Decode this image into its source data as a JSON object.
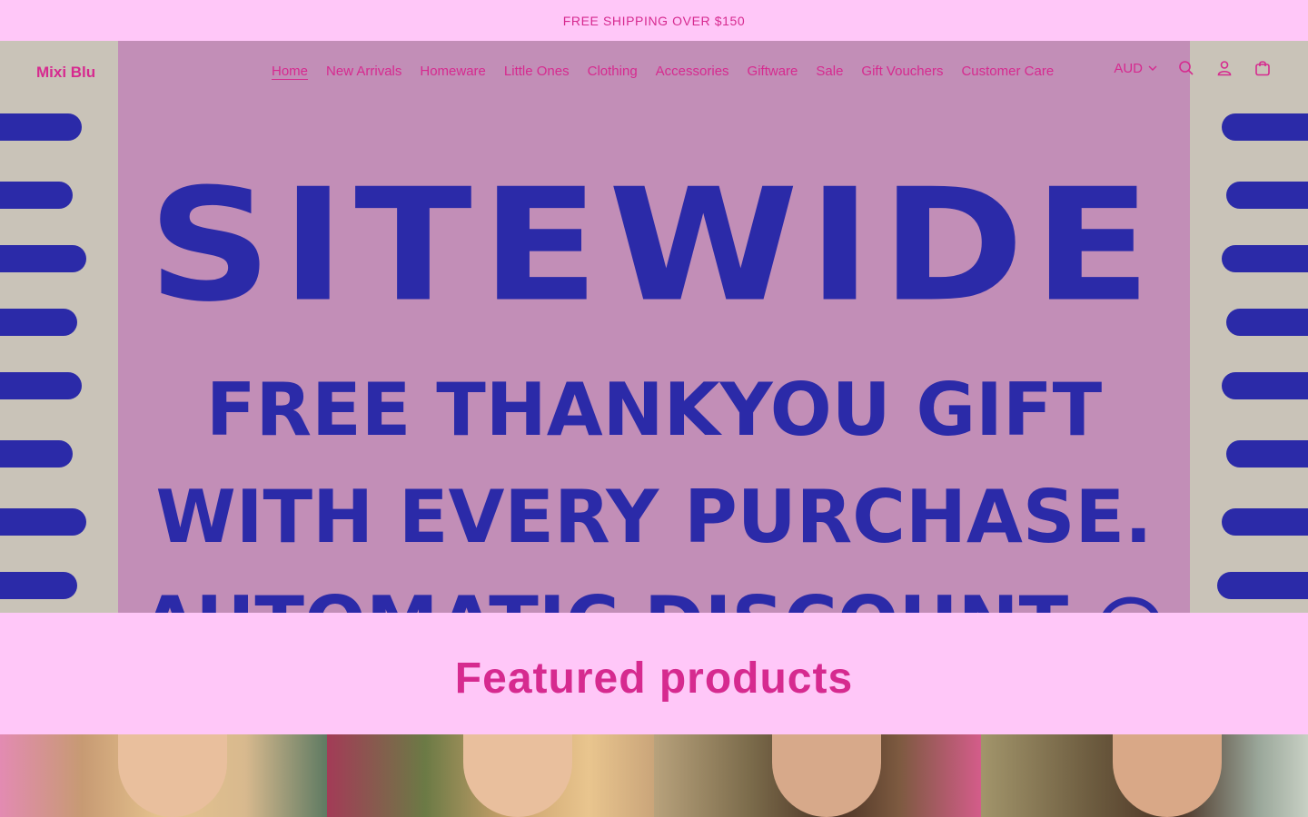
{
  "announcement": {
    "text": "FREE SHIPPING OVER $150"
  },
  "header": {
    "logo": "Mixi Blu",
    "nav": [
      {
        "label": "Home",
        "active": true
      },
      {
        "label": "New Arrivals"
      },
      {
        "label": "Homeware"
      },
      {
        "label": "Little Ones"
      },
      {
        "label": "Clothing"
      },
      {
        "label": "Accessories"
      },
      {
        "label": "Giftware"
      },
      {
        "label": "Sale"
      },
      {
        "label": "Gift Vouchers"
      },
      {
        "label": "Customer Care"
      }
    ],
    "currency": "AUD",
    "icons": [
      "chevron-down-icon",
      "search-icon",
      "account-icon",
      "cart-icon"
    ]
  },
  "hero": {
    "line1": "SITEWIDE",
    "line2": "FREE THANKYOU GIFT",
    "line3": "WITH EVERY PURCHASE.",
    "line4": "AUTOMATIC DISCOUNT @"
  },
  "featured": {
    "title": "Featured products"
  },
  "colors": {
    "accent": "#d62a8f",
    "background": "#ffc7f8",
    "hero_blue": "#2b2aa8",
    "hero_panel": "#c28eb7"
  }
}
